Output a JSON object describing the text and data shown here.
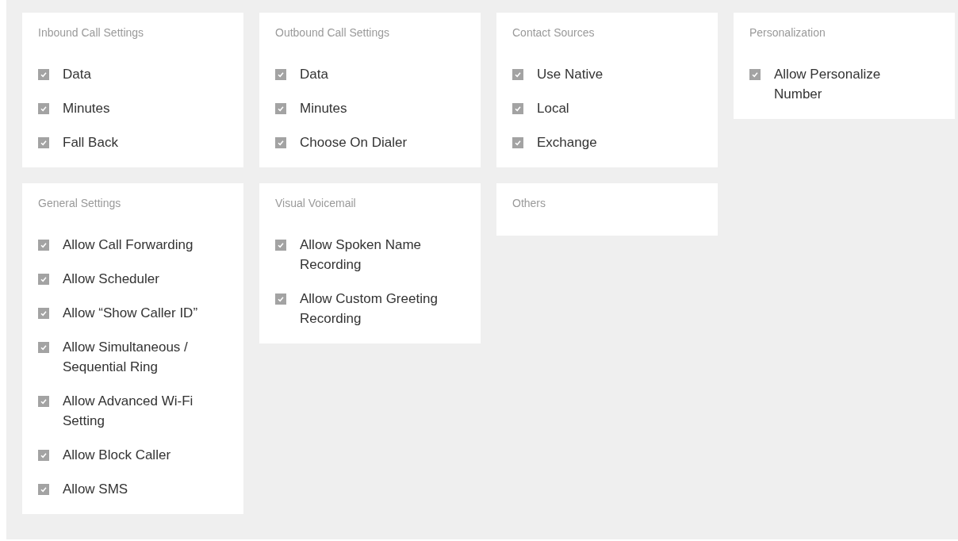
{
  "sections": [
    {
      "title": "Inbound Call Settings",
      "options": [
        {
          "label": "Data",
          "checked": true
        },
        {
          "label": "Minutes",
          "checked": true
        },
        {
          "label": "Fall Back",
          "checked": true
        }
      ]
    },
    {
      "title": "Outbound Call Settings",
      "options": [
        {
          "label": "Data",
          "checked": true
        },
        {
          "label": "Minutes",
          "checked": true
        },
        {
          "label": "Choose On Dialer",
          "checked": true
        }
      ]
    },
    {
      "title": "Contact Sources",
      "options": [
        {
          "label": "Use Native",
          "checked": true
        },
        {
          "label": "Local",
          "checked": true
        },
        {
          "label": "Exchange",
          "checked": true
        }
      ]
    },
    {
      "title": "Personalization",
      "options": [
        {
          "label": "Allow Personalize Number",
          "checked": true
        }
      ]
    },
    {
      "title": "General Settings",
      "options": [
        {
          "label": "Allow Call Forwarding",
          "checked": true
        },
        {
          "label": "Allow Scheduler",
          "checked": true
        },
        {
          "label": "Allow “Show Caller ID”",
          "checked": true
        },
        {
          "label": "Allow Simultaneous / Sequential Ring",
          "checked": true
        },
        {
          "label": "Allow Advanced Wi-Fi Setting",
          "checked": true
        },
        {
          "label": "Allow Block Caller",
          "checked": true
        },
        {
          "label": "Allow SMS",
          "checked": true
        }
      ]
    },
    {
      "title": "Visual Voicemail",
      "options": [
        {
          "label": "Allow Spoken Name Recording",
          "checked": true
        },
        {
          "label": "Allow Custom Greeting Recording",
          "checked": true
        }
      ]
    },
    {
      "title": "Others"
    }
  ]
}
